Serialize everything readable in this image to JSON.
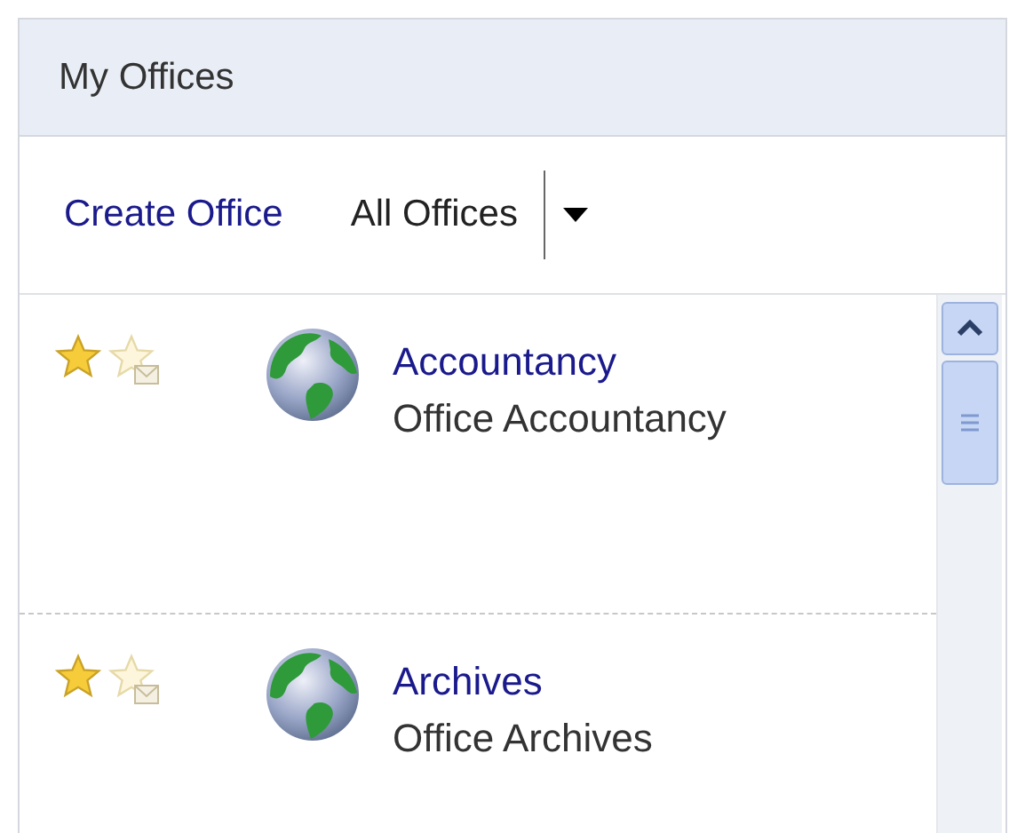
{
  "panel": {
    "title": "My Offices"
  },
  "toolbar": {
    "create_link": "Create Office",
    "filter": {
      "value": "All Offices"
    }
  },
  "offices": [
    {
      "name": "Accountancy",
      "description": "Office Accountancy",
      "favorite": true,
      "subscribed": false
    },
    {
      "name": "Archives",
      "description": "Office Archives",
      "favorite": true,
      "subscribed": false
    }
  ]
}
